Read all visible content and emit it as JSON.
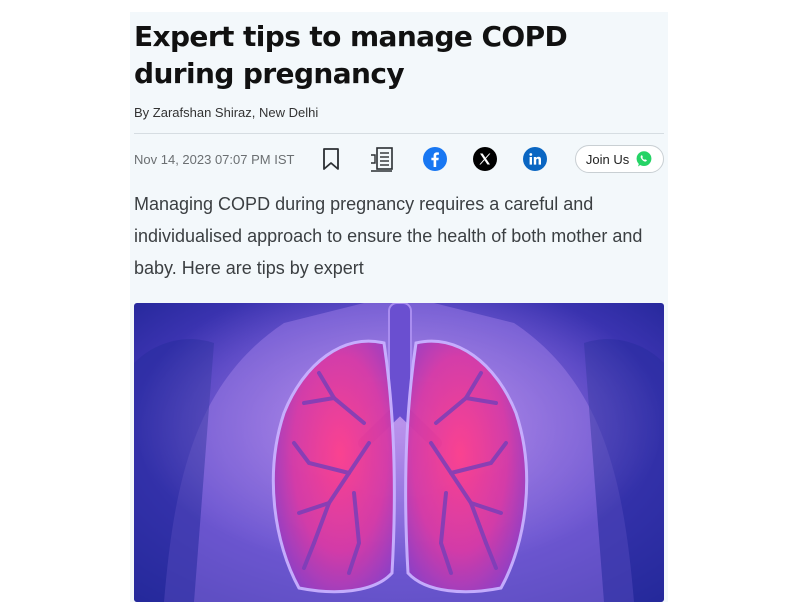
{
  "article": {
    "title": "Expert tips to manage COPD during pregnancy",
    "byline": "By Zarafshan Shiraz, New Delhi",
    "timestamp": "Nov 14, 2023 07:07 PM IST",
    "summary": "Managing COPD during pregnancy requires a careful and individualised approach to ensure the health of both mother and baby. Here are tips by expert"
  },
  "actions": {
    "join_label": "Join Us",
    "icons": [
      "bookmark-icon",
      "listen-icon",
      "facebook-icon",
      "x-twitter-icon",
      "linkedin-icon",
      "whatsapp-icon"
    ]
  },
  "colors": {
    "facebook": "#1877f2",
    "x": "#000000",
    "linkedin": "#0a66c2",
    "whatsapp": "#25d366",
    "panel_bg": "#f3f8fb"
  },
  "hero_image": {
    "subject": "lungs-illustration"
  }
}
